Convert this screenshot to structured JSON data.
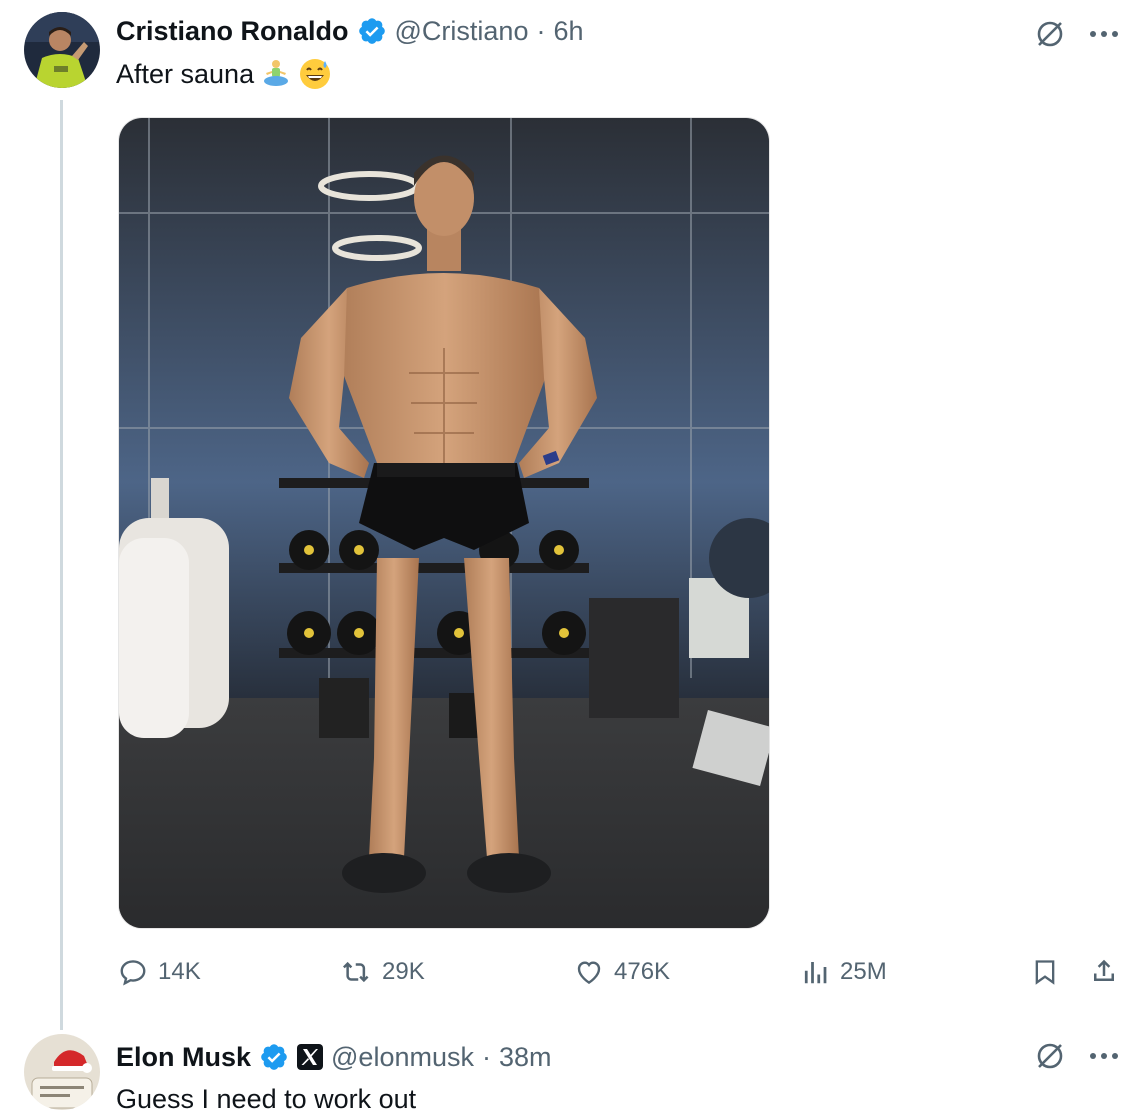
{
  "tweet": {
    "author_name": "Cristiano Ronaldo",
    "handle": "@Cristiano",
    "separator": "·",
    "time": "6h",
    "text": "After sauna",
    "emojis": [
      "person-in-lotus-position-emoji",
      "grinning-sweat-emoji"
    ],
    "stats": {
      "replies": "14K",
      "reposts": "29K",
      "likes": "476K",
      "views": "25M"
    }
  },
  "reply": {
    "author_name": "Elon Musk",
    "handle": "@elonmusk",
    "separator": "·",
    "time": "38m",
    "text": "Guess I need to work out"
  },
  "colors": {
    "verified": "#1d9bf0",
    "secondary_text": "#536471",
    "thread_line": "#cfd9de"
  }
}
